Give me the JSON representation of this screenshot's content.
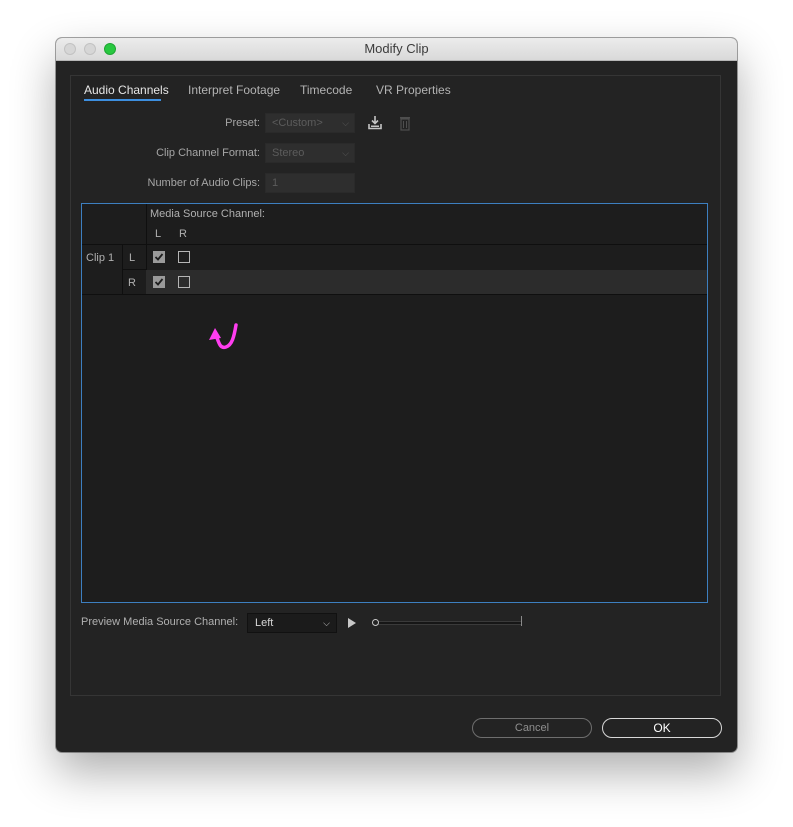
{
  "window": {
    "title": "Modify Clip"
  },
  "tabs": [
    {
      "label": "Audio Channels",
      "active": true
    },
    {
      "label": "Interpret Footage",
      "active": false
    },
    {
      "label": "Timecode",
      "active": false
    },
    {
      "label": "VR Properties",
      "active": false
    }
  ],
  "form": {
    "preset_label": "Preset:",
    "preset_value": "<Custom>",
    "format_label": "Clip Channel Format:",
    "format_value": "Stereo",
    "num_clips_label": "Number of Audio Clips:",
    "num_clips_value": "1"
  },
  "icons": {
    "save_preset": "download-tray-icon",
    "delete_preset": "trash-icon",
    "annotation": "pink-curved-arrow-icon"
  },
  "grid": {
    "header": "Media Source Channel:",
    "columns": [
      "L",
      "R"
    ],
    "clip_label": "Clip 1",
    "rows": [
      {
        "channel": "L",
        "checks": [
          true,
          false
        ]
      },
      {
        "channel": "R",
        "checks": [
          true,
          false
        ]
      }
    ]
  },
  "preview": {
    "label": "Preview Media Source Channel:",
    "selected": "Left"
  },
  "buttons": {
    "cancel": "Cancel",
    "ok": "OK"
  },
  "colors": {
    "accent": "#3d8fe0",
    "annotation": "#ff3df0",
    "zoom_button": "#28c840"
  }
}
